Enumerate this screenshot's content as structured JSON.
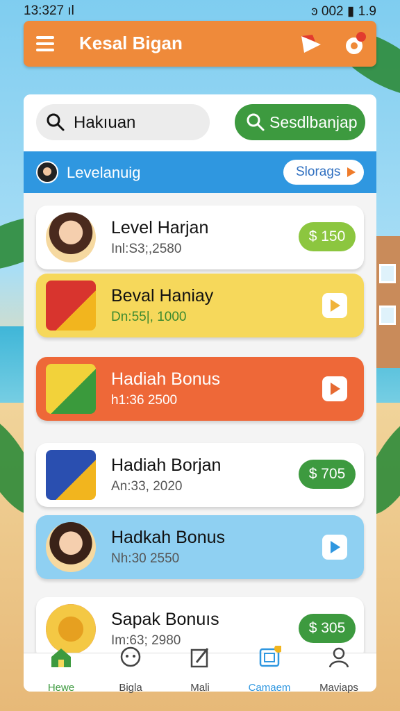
{
  "status_bar": {
    "time": "13:327 ıl",
    "right": "ͽ 002 ▮ 1.9"
  },
  "header": {
    "title": "Kesal Bigan"
  },
  "search": {
    "text": "Hakıuan",
    "button_label": "Sesdlbanjap"
  },
  "level_bar": {
    "label": "Levelanuig",
    "storage_label": "Slorags"
  },
  "items": [
    {
      "title": "Level Harjan",
      "sub": "Inl:S3;,2580",
      "action": "$ 150",
      "style": "white",
      "thumb": "avatar-girl"
    },
    {
      "title": "Beval Haniay",
      "sub": "Dn:55|, 1000",
      "action": "play",
      "style": "yellow",
      "thumb": "coin-bag"
    },
    {
      "title": "Hadiah Bonus",
      "sub": "h1:36 2500",
      "action": "play",
      "style": "orange",
      "thumb": "coin-bag"
    },
    {
      "title": "Hadiah Borjan",
      "sub": "An:33, 2020",
      "action": "$ 705",
      "style": "white",
      "thumb": "coin-bag"
    },
    {
      "title": "Hadkah Bonus",
      "sub": "Nh:30 2550",
      "action": "play",
      "style": "blue",
      "thumb": "avatar-girl"
    },
    {
      "title": "Sapak Bonuıs",
      "sub": "Im:63; 2980",
      "action": "$ 305",
      "style": "white",
      "thumb": "coin-stack"
    }
  ],
  "nav": [
    {
      "label": "Hewe",
      "icon": "home-icon"
    },
    {
      "label": "Bigla",
      "icon": "chat-icon"
    },
    {
      "label": "Mali",
      "icon": "edit-icon"
    },
    {
      "label": "Camaem",
      "icon": "camera-icon"
    },
    {
      "label": "Maviaps",
      "icon": "profile-icon"
    }
  ],
  "colors": {
    "accent_orange": "#ef8a3a",
    "green": "#3d9a3f",
    "blue": "#2f97e0",
    "price_lime": "#8cc63f"
  }
}
